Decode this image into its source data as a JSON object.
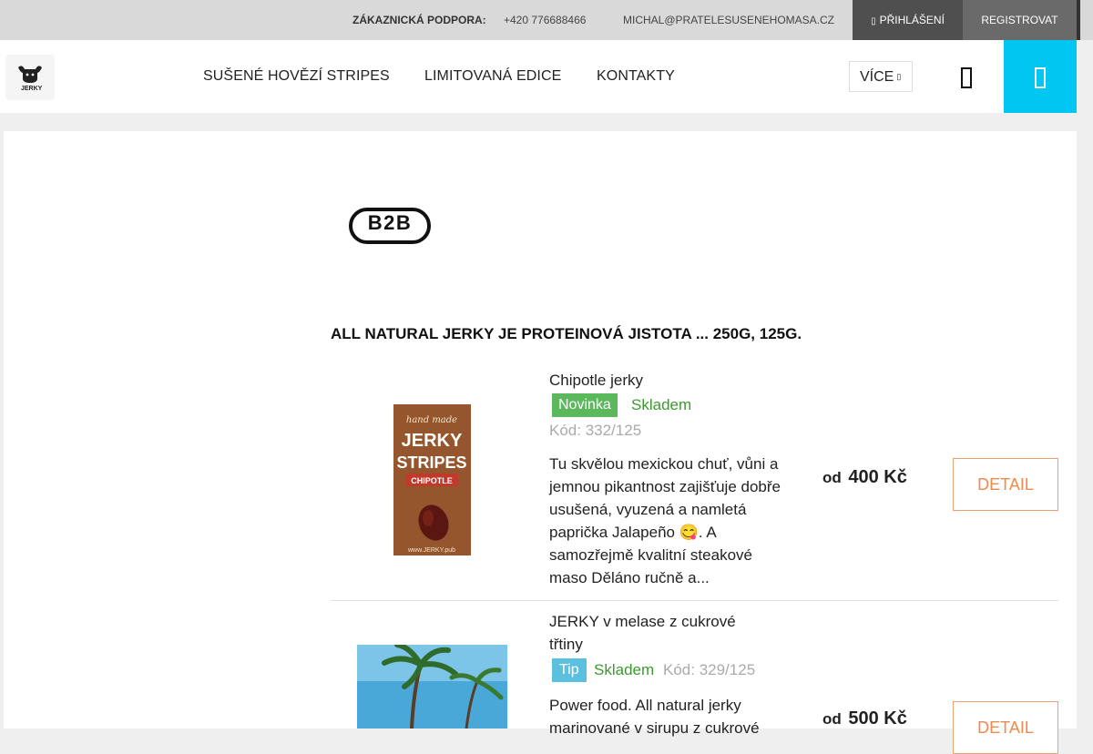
{
  "topbar": {
    "support_label": "ZÁKAZNICKÁ PODPORA:",
    "phone": "+420 776688466",
    "email": "MICHAL@PRATELESUSENEHOMASA.CZ",
    "login": "PŘIHLÁŠENÍ",
    "register": "REGISTROVAT"
  },
  "header": {
    "logo_text": "JERKY",
    "nav": [
      "SUŠENÉ HOVĚZÍ STRIPES",
      "LIMITOVANÁ EDICE",
      "KONTAKTY"
    ],
    "more_label": "VÍCE",
    "accent_color": "#00c7f2"
  },
  "main": {
    "b2b_label": "B2B",
    "heading": "ALL NATURAL JERKY JE PROTEINOVÁ JISTOTA ... 250G, 125G.",
    "products": [
      {
        "name": "Chipotle jerky",
        "badge": "Novinka",
        "stock": "Skladem",
        "code": "Kód: 332/125",
        "description": "Tu skvělou mexickou chuť, vůni a jemnou pikantnost zajišťuje dobře usušená, vyuzená a namletá paprička Jalapeño 😋. A samozřejmě kvalitní steakové maso  Děláno ručně a...",
        "price_prefix": "od",
        "price": "400 Kč",
        "detail_label": "DETAIL",
        "image_text": {
          "line1": "hand made",
          "line2": "JERKY",
          "line3": "STRIPES",
          "line4": "CHIPOTLE",
          "line5": "www.JERKY.pub"
        }
      },
      {
        "name": "JERKY v melase z cukrové třtiny",
        "badge": "Tip",
        "stock": "Skladem",
        "code": "Kód: 329/125",
        "description": "Power food. All natural jerky marinované v sirupu z cukrové",
        "price_prefix": "od",
        "price": "500 Kč",
        "detail_label": "DETAIL"
      }
    ]
  }
}
